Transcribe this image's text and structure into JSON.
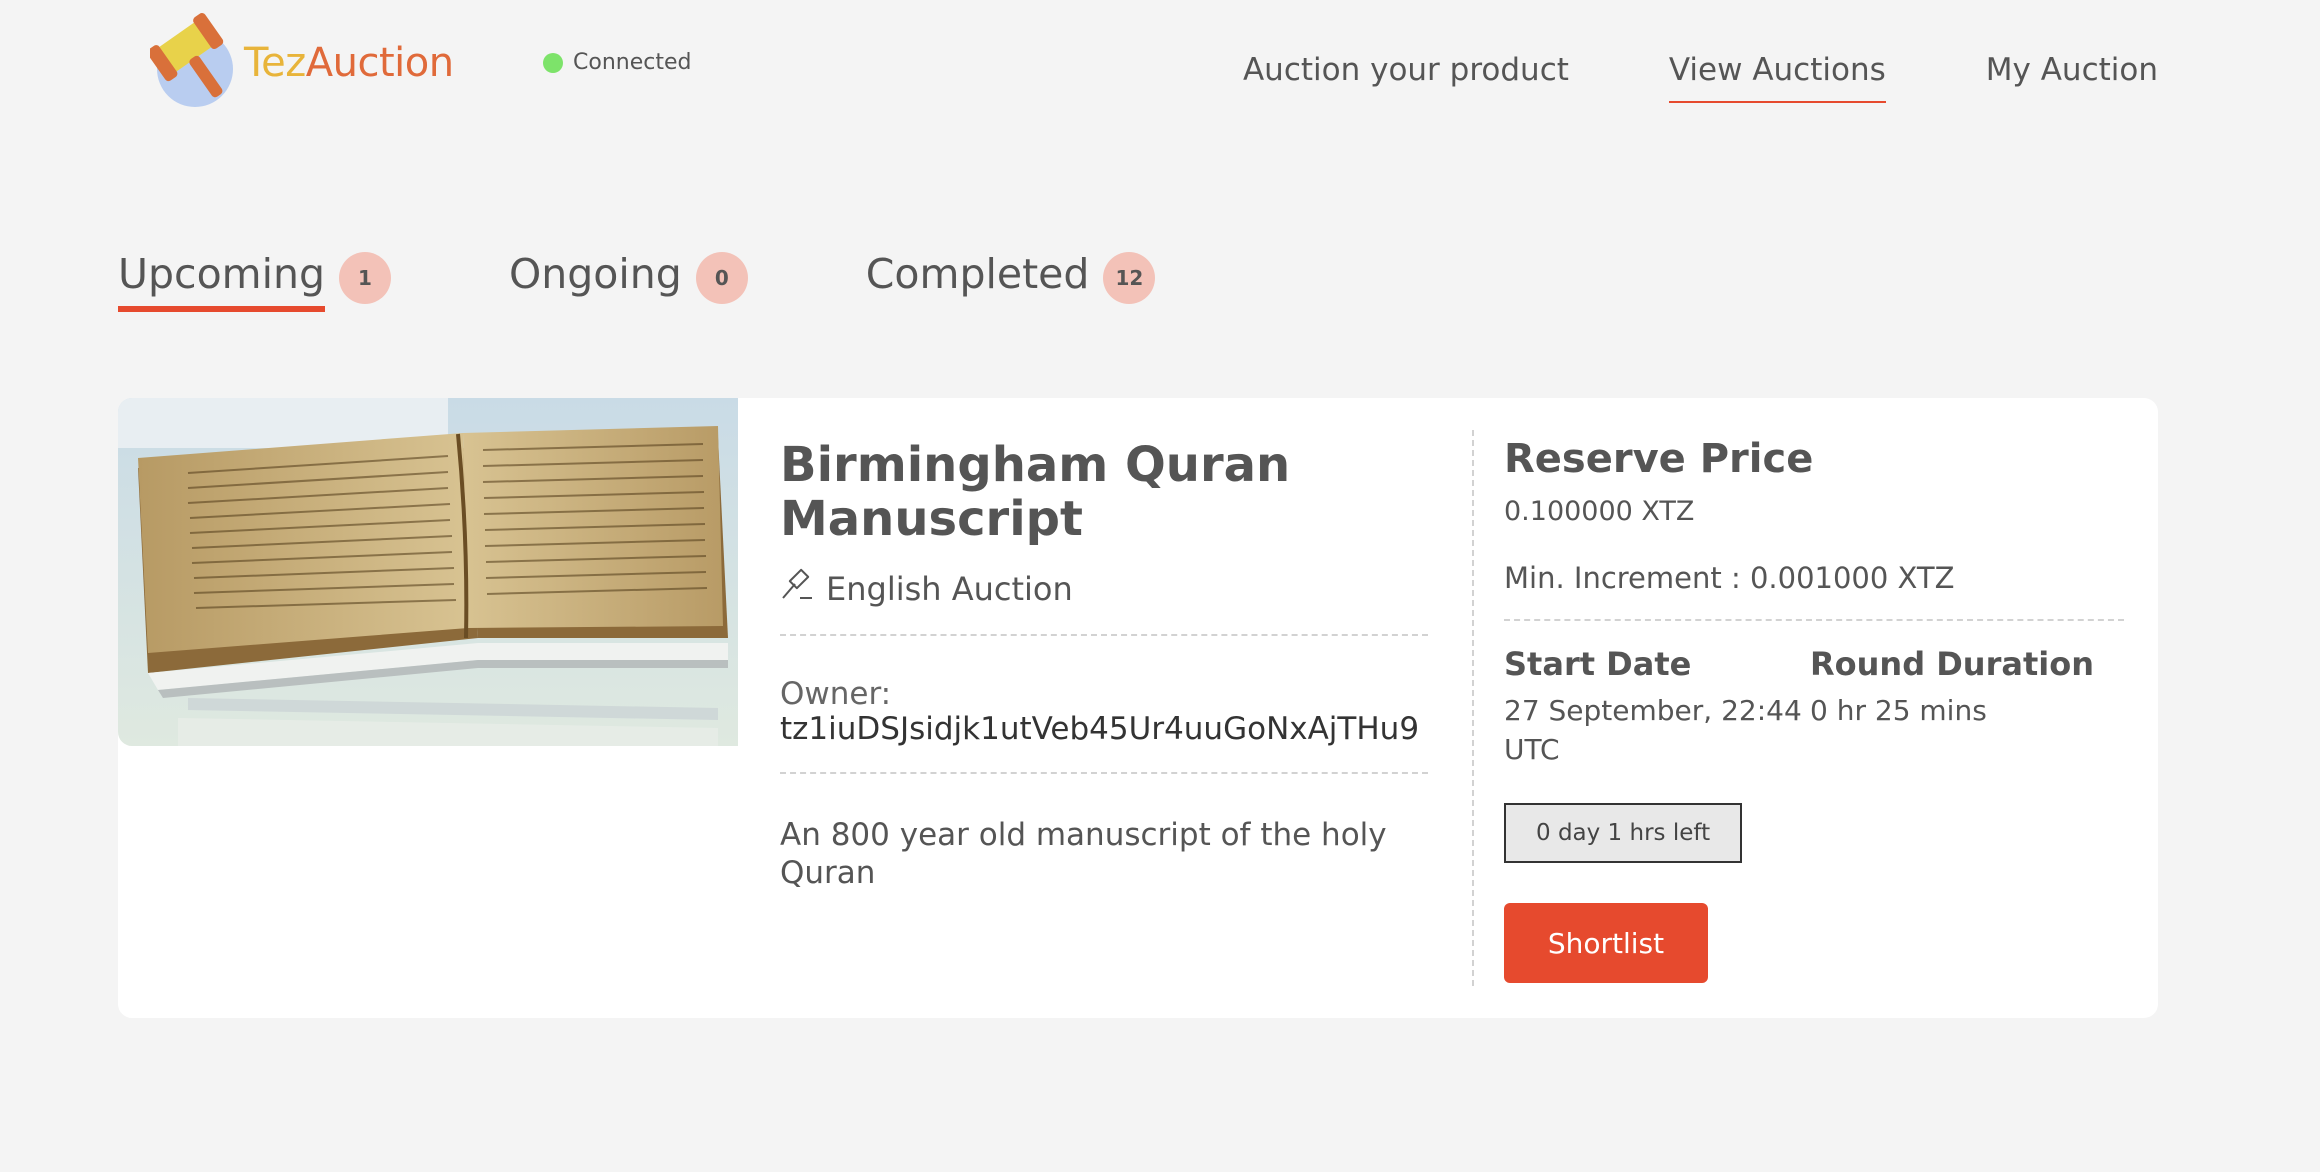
{
  "header": {
    "logo_text_part1": "Tez",
    "logo_text_part2": "Auction",
    "connection_status": "Connected",
    "nav": [
      {
        "label": "Auction your product"
      },
      {
        "label": "View Auctions"
      },
      {
        "label": "My Auction"
      }
    ],
    "active_nav": "View Auctions"
  },
  "tabs": [
    {
      "label": "Upcoming",
      "count": "1"
    },
    {
      "label": "Ongoing",
      "count": "0"
    },
    {
      "label": "Completed",
      "count": "12"
    }
  ],
  "active_tab": "Upcoming",
  "auction": {
    "title": "Birmingham Quran Manuscript",
    "type_icon": "gavel-icon",
    "type": "English Auction",
    "owner_label": "Owner:",
    "owner": "tz1iuDSJsidjk1utVeb45Ur4uuGoNxAjTHu9",
    "description": "An 800 year old manuscript of the holy Quran",
    "reserve_title": "Reserve Price",
    "reserve_value": "0.100000 XTZ",
    "min_increment": "Min. Increment : 0.001000 XTZ",
    "start_date_label": "Start Date",
    "start_date": "27 September, 22:44 UTC",
    "round_duration_label": "Round Duration",
    "round_duration": "0 hr 25 mins",
    "time_left": "0 day 1 hrs left",
    "shortlist_label": "Shortlist"
  },
  "colors": {
    "accent": "#e64a2e",
    "badge": "#f3c2b8",
    "connected": "#7de36a",
    "background": "#f4f4f4"
  }
}
